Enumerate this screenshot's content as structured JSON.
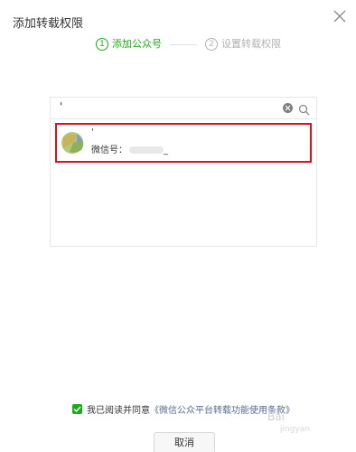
{
  "dialog": {
    "title": "添加转载权限",
    "close_icon": "close-icon"
  },
  "steps": [
    {
      "number": "1",
      "label": "添加公众号",
      "active": true
    },
    {
      "number": "2",
      "label": "设置转载权限",
      "active": false
    }
  ],
  "search": {
    "value": "'",
    "clear_icon": "clear-icon",
    "search_icon": "search-icon"
  },
  "result": {
    "name": "'",
    "wechat_label": "微信号：",
    "wechat_suffix": "_",
    "avatar_icon": "avatar-icon"
  },
  "agreement": {
    "checked": true,
    "text": "我已阅读并同意",
    "link": "《微信公众平台转载功能使用条款》"
  },
  "footer": {
    "cancel_label": "取消"
  },
  "watermark": {
    "text": "Bai",
    "sub": "jingyan"
  },
  "colors": {
    "accent": "#1aad19",
    "highlight_border": "#d9121b",
    "link": "#576b95"
  }
}
